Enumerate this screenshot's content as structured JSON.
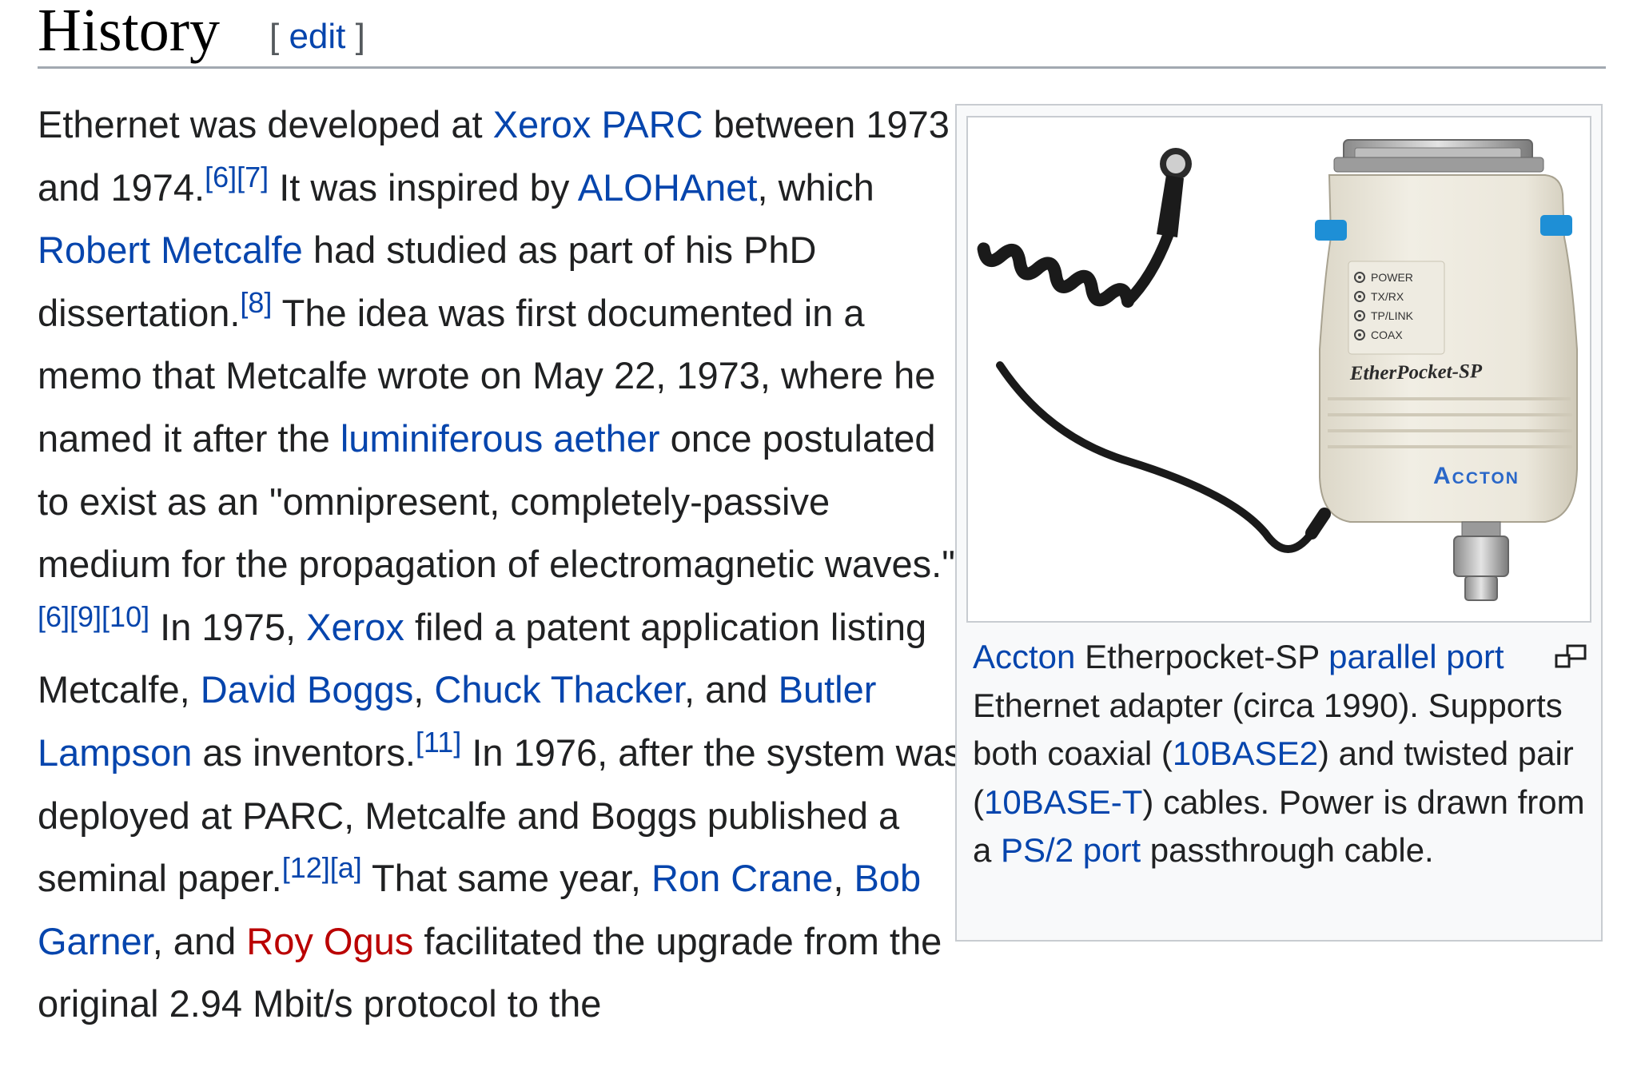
{
  "section": {
    "title": "History",
    "edit_open": "[ ",
    "edit_label": "edit",
    "edit_close": " ]"
  },
  "paragraph": {
    "t1": "Ethernet was developed at ",
    "l1": "Xerox PARC",
    "t2": " between 1973 and 1974.",
    "r1": "[6][7]",
    "t3": " It was inspired by ",
    "l2": "ALOHAnet",
    "t4": ", which ",
    "l3": "Robert Metcalfe",
    "t5": " had studied as part of his PhD dissertation.",
    "r2": "[8]",
    "t6": " The idea was first documented in a memo that Metcalfe wrote on May 22, 1973, where he named it after the ",
    "l4": "luminiferous aether",
    "t7": " once postulated to exist as an \"omnipresent, completely-passive medium for the propagation of electromagnetic waves.\"",
    "r3": "[6][9][10]",
    "t8": " In 1975, ",
    "l5": "Xerox",
    "t9": " filed a patent application listing Metcalfe, ",
    "l6": "David Boggs",
    "t10": ", ",
    "l7": "Chuck Thacker",
    "t11": ", and ",
    "l8": "Butler Lampson",
    "t12": " as inventors.",
    "r4": "[11]",
    "t13": " In 1976, after the system was deployed at PARC, Metcalfe and Boggs published a seminal paper.",
    "r5": "[12][a]",
    "t14": " That same year, ",
    "l9": "Ron Crane",
    "t15": ", ",
    "l10": "Bob Garner",
    "t16": ", and ",
    "l11": "Roy Ogus",
    "t17": " facilitated the upgrade from the original 2.94 Mbit/s protocol to the"
  },
  "figure": {
    "device": {
      "leds": [
        "POWER",
        "TX/RX",
        "TP/LINK",
        "COAX"
      ],
      "model": "EtherPocket-SP",
      "brand": "Accton"
    },
    "caption": {
      "l1": "Accton",
      "t1": " Etherpocket-SP ",
      "l2": "parallel port",
      "t2": " Ethernet adapter (circa 1990). Supports both coaxial (",
      "l3": "10BASE2",
      "t3": ") and twisted pair (",
      "l4": "10BASE-T",
      "t4": ") cables. Power is drawn from a ",
      "l5": "PS/2 port",
      "t5": " passthrough cable."
    }
  },
  "colors": {
    "link": "#0645ad",
    "redlink": "#ba0000",
    "text": "#202122",
    "border": "#a2a9b1"
  }
}
